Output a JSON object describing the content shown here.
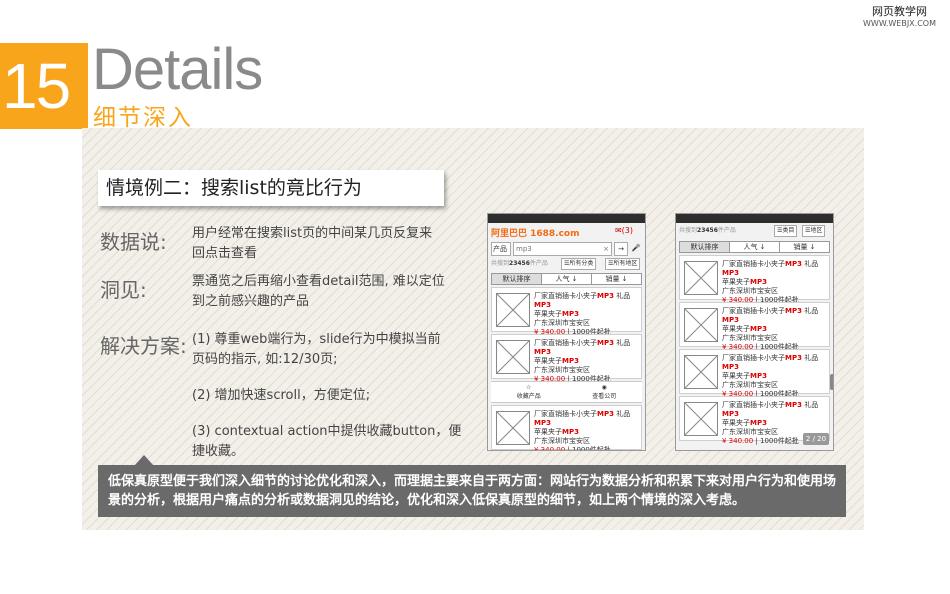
{
  "watermark": {
    "main": "网页教学网",
    "sub": "WWW.WEBJX.COM"
  },
  "header": {
    "number": "15",
    "title_en": "Details",
    "title_cn": "细节深入"
  },
  "scene_title": "情境例二：搜索list的竟比行为",
  "sections": {
    "data": {
      "label": "数据说:",
      "text": [
        "用户经常在搜索list页的中间某几页反复来",
        "回点击查看"
      ]
    },
    "insight": {
      "label": "洞见:",
      "text": [
        "票通览之后再缩小查看detail范围, 难以定位",
        "到之前感兴趣的产品"
      ]
    },
    "solution": {
      "label": "解决方案:",
      "items": [
        [
          "(1) 尊重web端行为，slide行为中模拟当前",
          "页码的指示, 如:12/30页;"
        ],
        [
          "(2) 增加快速scroll，方便定位;"
        ],
        [
          "(3) contextual action中提供收藏button，便",
          "捷收藏。"
        ]
      ]
    }
  },
  "summary": "低保真原型便于我们深入细节的讨论优化和深入，而理据主要来自于两方面：网站行为数据分析和积累下来对用户行为和使用场景的分析，根据用户痛点的分析或数据洞见的结论，优化和深入低保真原型的细节，如上两个情境的深入考虑。",
  "phone1": {
    "logo": "阿里巴巴 1688.com",
    "msg": "(3)",
    "search_cat": "产品",
    "search_value": "mp3",
    "search_clear": "×",
    "search_go": "→",
    "mic_icon": "microphone-icon",
    "count": {
      "prefix": "共搜到",
      "num": "23456",
      "suffix": "件产品"
    },
    "filter_cat": "所有分类",
    "filter_region": "所有地区",
    "sort": [
      "默认排序",
      "人气 ↓",
      "销量 ↓"
    ],
    "action_fav": "收藏产品",
    "action_view": "查看公司",
    "items": [
      {
        "a": "厂家直销插卡小夹子",
        "b": "MP3",
        "c": " 礼品",
        "d": "MP3",
        "e": "苹果夹子",
        "f": "MP3",
        "g": "广东深圳市宝安区",
        "price": "¥ 340.00",
        "min": "| 1000件起批"
      }
    ]
  },
  "phone2": {
    "count": {
      "prefix": "共搜到",
      "num": "23456",
      "suffix": "件产品"
    },
    "filter_cat": "类目",
    "filter_region": "地区",
    "sort": [
      "默认排序",
      "人气 ↓",
      "销量 ↓"
    ],
    "pager": "2 / 20",
    "item": {
      "a": "厂家直销插卡小夹子",
      "b": "MP3",
      "c": " 礼品",
      "d": "MP3",
      "e": "苹果夹子",
      "f": "MP3",
      "g": "广东深圳市宝安区",
      "price": "¥ 340.00",
      "min": "| 1000件起批"
    }
  }
}
